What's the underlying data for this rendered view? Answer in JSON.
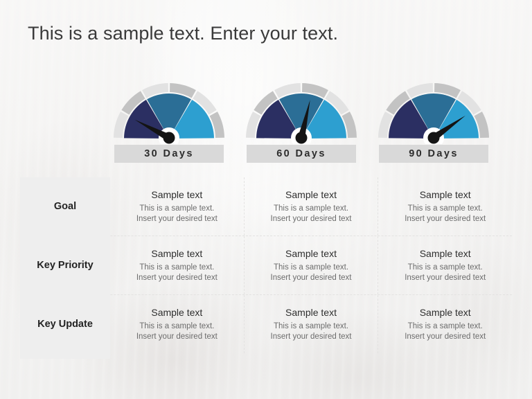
{
  "slide": {
    "title": "This is a sample text. Enter your text.",
    "background_color": "#f4f3f1"
  },
  "palette": {
    "segment_dark_navy": "#2b2f62",
    "segment_medium_blue": "#2b6e96",
    "segment_light_blue": "#2d9fd0",
    "ring_light_gray": "#e2e2e2",
    "ring_dark_gray": "#c3c3c3",
    "needle_black": "#141414",
    "band_gray": "#d9d9d9",
    "label_cell_gray": "#eeeeee",
    "divider_gray": "#e3e2e1"
  },
  "gauges": [
    {
      "id": "gauge-30-days",
      "label": "30 Days",
      "needle_angle_deg": 208,
      "needle_icon": "gauge-needle-icon"
    },
    {
      "id": "gauge-60-days",
      "label": "60 Days",
      "needle_angle_deg": 283,
      "needle_icon": "gauge-needle-icon"
    },
    {
      "id": "gauge-90-days",
      "label": "90 Days",
      "needle_angle_deg": 325,
      "needle_icon": "gauge-needle-icon"
    }
  ],
  "matrix": {
    "row_labels": [
      "Goal",
      "Key Priority",
      "Key Update"
    ],
    "columns": [
      "30 Days",
      "60 Days",
      "90 Days"
    ],
    "cell": {
      "heading": "Sample text",
      "line1": "This is a sample text.",
      "line2": "Insert your desired text"
    },
    "rows": [
      {
        "label": "Goal",
        "cells": [
          {
            "heading": "Sample text",
            "line1": "This is a sample text.",
            "line2": "Insert your desired text"
          },
          {
            "heading": "Sample text",
            "line1": "This is a sample text.",
            "line2": "Insert your desired text"
          },
          {
            "heading": "Sample text",
            "line1": "This is a sample text.",
            "line2": "Insert your desired text"
          }
        ]
      },
      {
        "label": "Key Priority",
        "cells": [
          {
            "heading": "Sample text",
            "line1": "This is a sample text.",
            "line2": "Insert your desired text"
          },
          {
            "heading": "Sample text",
            "line1": "This is a sample text.",
            "line2": "Insert your desired text"
          },
          {
            "heading": "Sample text",
            "line1": "This is a sample text.",
            "line2": "Insert your desired text"
          }
        ]
      },
      {
        "label": "Key Update",
        "cells": [
          {
            "heading": "Sample text",
            "line1": "This is a sample text.",
            "line2": "Insert your desired text"
          },
          {
            "heading": "Sample text",
            "line1": "This is a sample text.",
            "line2": "Insert your desired text"
          },
          {
            "heading": "Sample text",
            "line1": "This is a sample text.",
            "line2": "Insert your desired text"
          }
        ]
      }
    ]
  },
  "chart_data": {
    "type": "gauge",
    "title": "This is a sample text. Enter your text.",
    "gauges": [
      {
        "name": "30 Days",
        "needle_angle_deg": 208,
        "needle_value_fraction": 0.18,
        "arc_start_deg": 180,
        "arc_end_deg": 360,
        "inner_segments": [
          {
            "color": "#2b2f62",
            "start_deg": 180,
            "end_deg": 240
          },
          {
            "color": "#2b6e96",
            "start_deg": 240,
            "end_deg": 300
          },
          {
            "color": "#2d9fd0",
            "start_deg": 300,
            "end_deg": 360
          }
        ],
        "outer_ring_segments": [
          {
            "color": "#e2e2e2",
            "start_deg": 180,
            "end_deg": 210
          },
          {
            "color": "#c3c3c3",
            "start_deg": 210,
            "end_deg": 240
          },
          {
            "color": "#e2e2e2",
            "start_deg": 240,
            "end_deg": 270
          },
          {
            "color": "#c3c3c3",
            "start_deg": 270,
            "end_deg": 300
          },
          {
            "color": "#e2e2e2",
            "start_deg": 300,
            "end_deg": 330
          },
          {
            "color": "#c3c3c3",
            "start_deg": 330,
            "end_deg": 360
          }
        ]
      },
      {
        "name": "60 Days",
        "needle_angle_deg": 283,
        "needle_value_fraction": 0.57,
        "arc_start_deg": 180,
        "arc_end_deg": 360,
        "inner_segments": [
          {
            "color": "#2b2f62",
            "start_deg": 180,
            "end_deg": 240
          },
          {
            "color": "#2b6e96",
            "start_deg": 240,
            "end_deg": 300
          },
          {
            "color": "#2d9fd0",
            "start_deg": 300,
            "end_deg": 360
          }
        ],
        "outer_ring_segments": [
          {
            "color": "#e2e2e2",
            "start_deg": 180,
            "end_deg": 210
          },
          {
            "color": "#c3c3c3",
            "start_deg": 210,
            "end_deg": 240
          },
          {
            "color": "#e2e2e2",
            "start_deg": 240,
            "end_deg": 270
          },
          {
            "color": "#c3c3c3",
            "start_deg": 270,
            "end_deg": 300
          },
          {
            "color": "#e2e2e2",
            "start_deg": 300,
            "end_deg": 330
          },
          {
            "color": "#c3c3c3",
            "start_deg": 330,
            "end_deg": 360
          }
        ]
      },
      {
        "name": "90 Days",
        "needle_angle_deg": 325,
        "needle_value_fraction": 0.81,
        "arc_start_deg": 180,
        "arc_end_deg": 360,
        "inner_segments": [
          {
            "color": "#2b2f62",
            "start_deg": 180,
            "end_deg": 240
          },
          {
            "color": "#2b6e96",
            "start_deg": 240,
            "end_deg": 300
          },
          {
            "color": "#2d9fd0",
            "start_deg": 300,
            "end_deg": 360
          }
        ],
        "outer_ring_segments": [
          {
            "color": "#e2e2e2",
            "start_deg": 180,
            "end_deg": 210
          },
          {
            "color": "#c3c3c3",
            "start_deg": 210,
            "end_deg": 240
          },
          {
            "color": "#e2e2e2",
            "start_deg": 240,
            "end_deg": 270
          },
          {
            "color": "#c3c3c3",
            "start_deg": 270,
            "end_deg": 300
          },
          {
            "color": "#e2e2e2",
            "start_deg": 300,
            "end_deg": 330
          },
          {
            "color": "#c3c3c3",
            "start_deg": 330,
            "end_deg": 360
          }
        ]
      }
    ],
    "legend_position": "below-each-gauge",
    "grid": false
  }
}
